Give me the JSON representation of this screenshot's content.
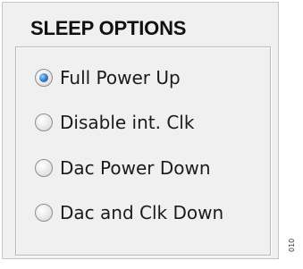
{
  "panel": {
    "title": "SLEEP OPTIONS"
  },
  "sleep_options": [
    {
      "label": "Full Power Up",
      "checked": true
    },
    {
      "label": "Disable int. Clk",
      "checked": false
    },
    {
      "label": "Dac Power Down",
      "checked": false
    },
    {
      "label": "Dac and Clk Down",
      "checked": false
    }
  ],
  "figure_code": "010",
  "colors": {
    "panel_background": "#f0f0f0",
    "radio_selected": "#3f86d6"
  }
}
